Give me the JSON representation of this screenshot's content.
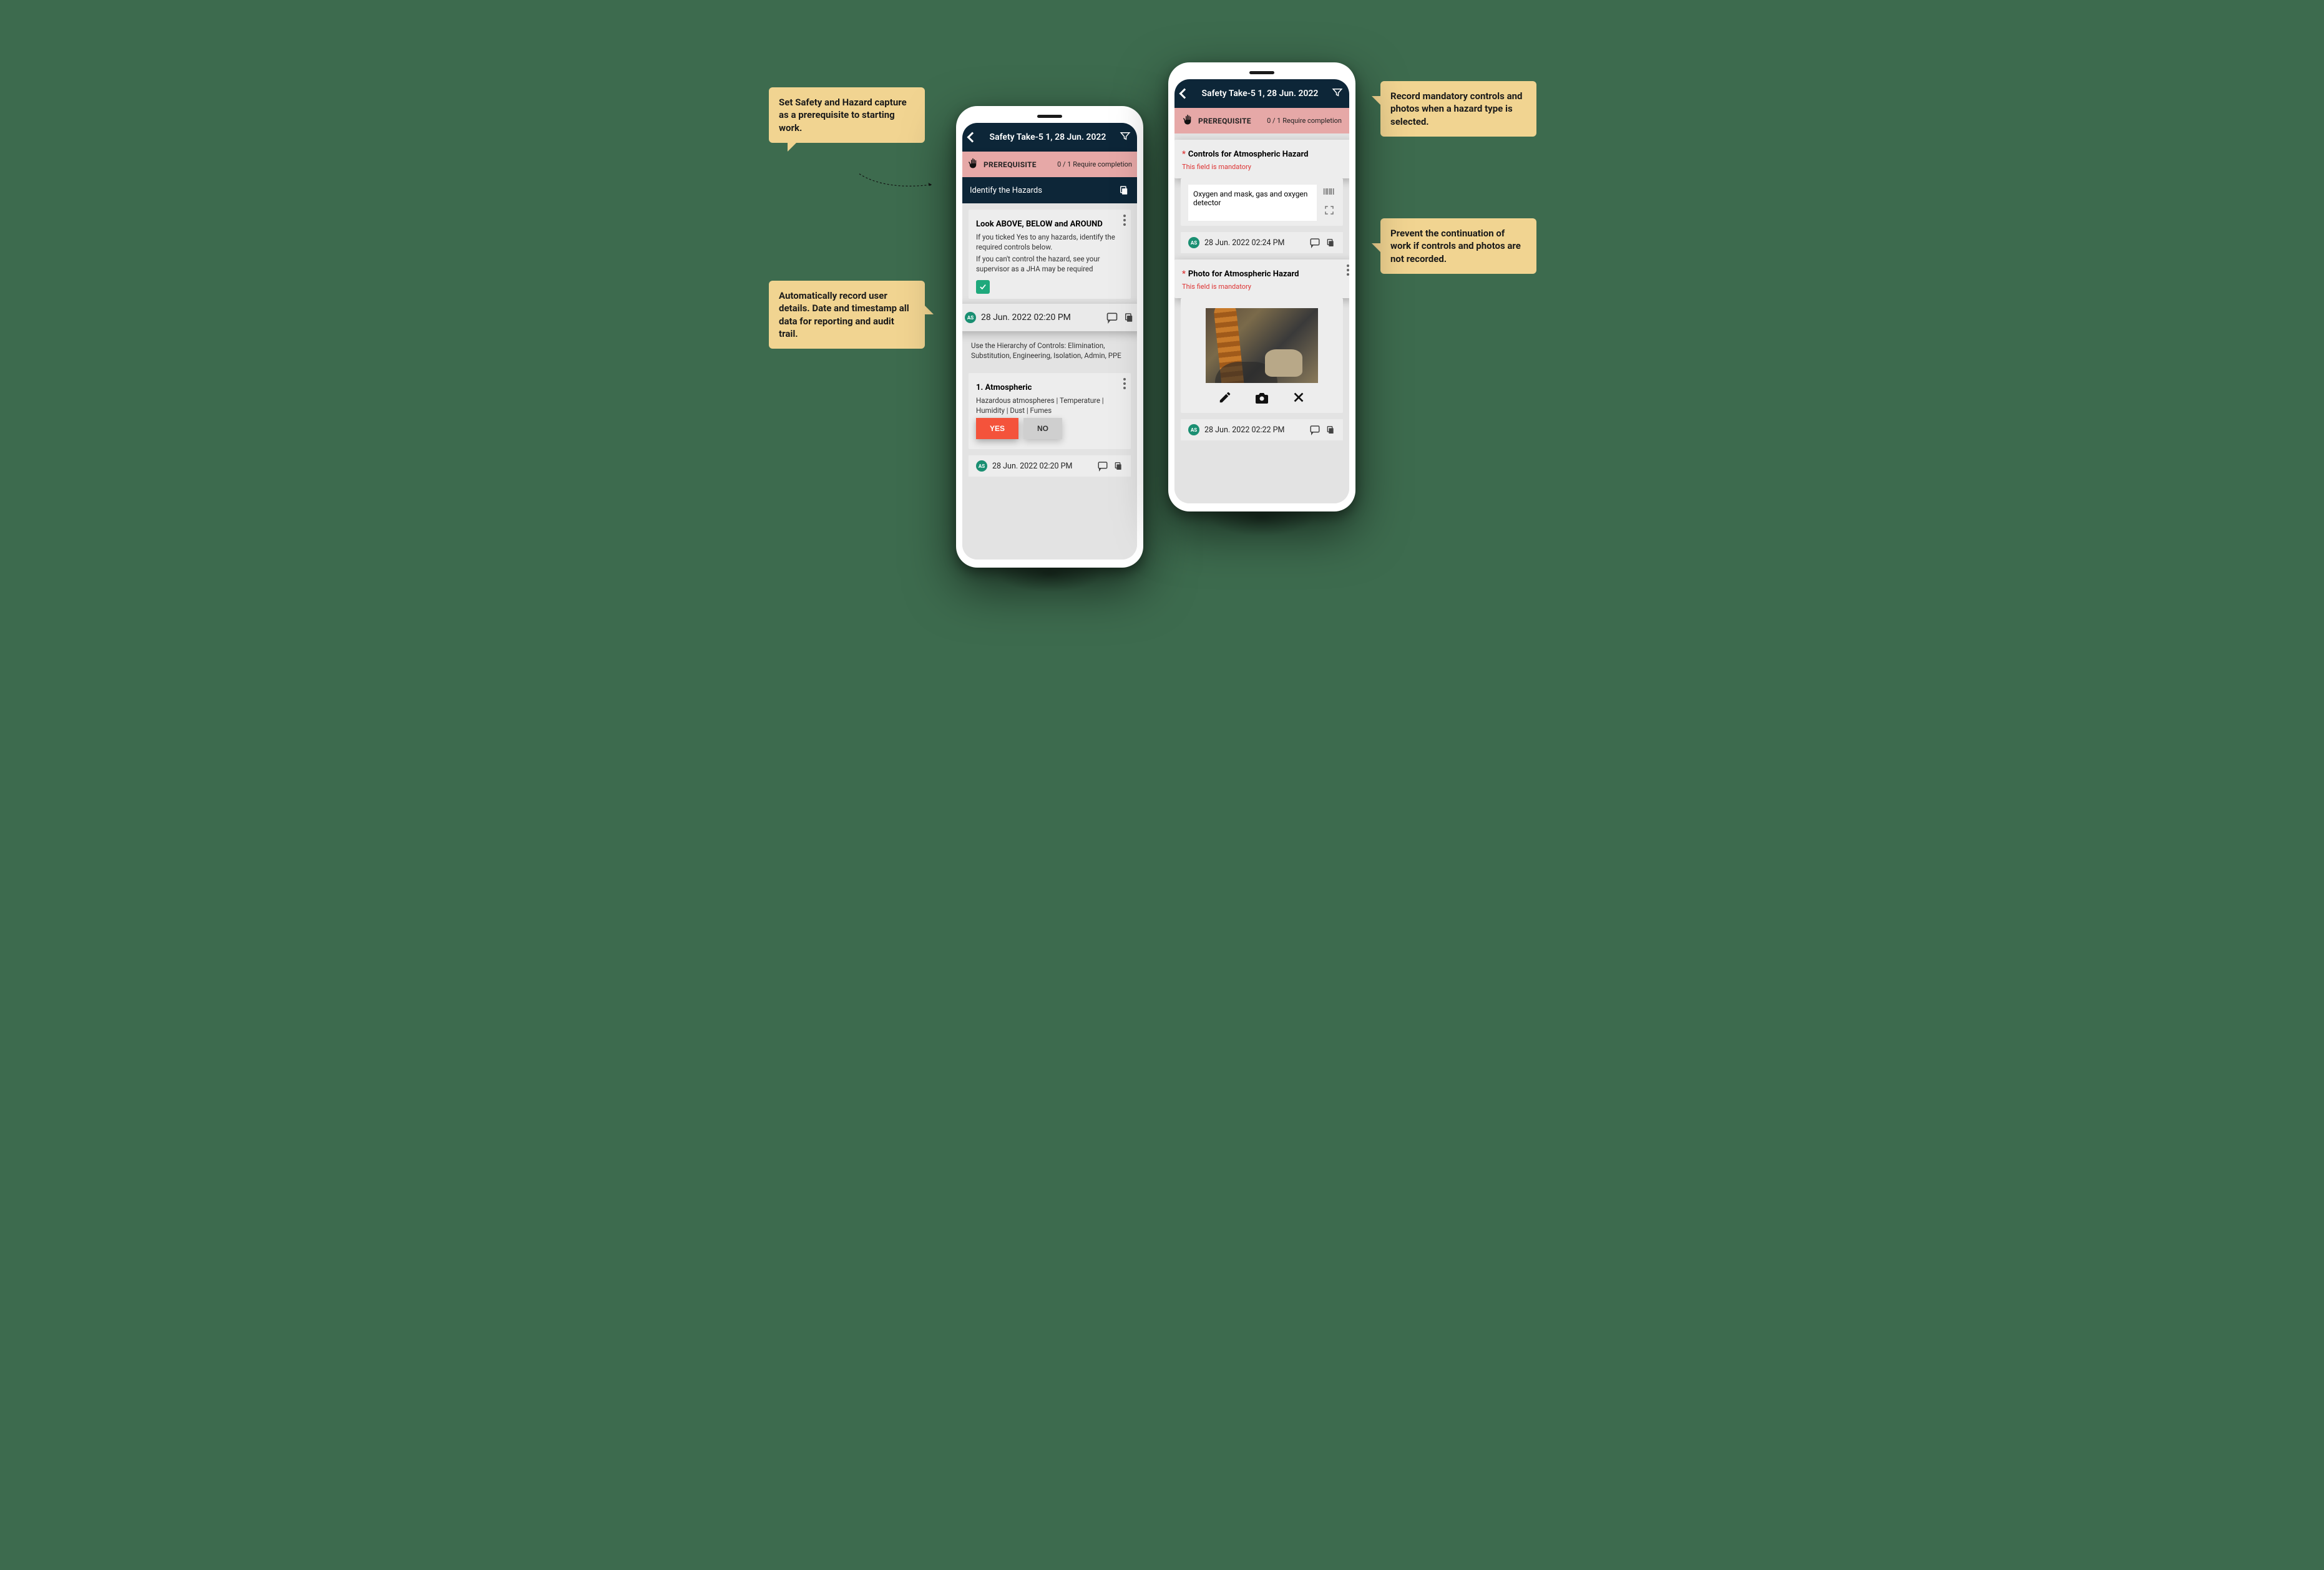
{
  "callouts": {
    "c1": "Set Safety and Hazard capture as a prerequisite to starting work.",
    "c2": "Automatically record user details. Date and timestamp all data for reporting and audit trail.",
    "c3": "Record mandatory controls and photos when a hazard type is selected.",
    "c4": "Prevent the continuation of work if controls and photos are not recorded."
  },
  "phone1": {
    "title": "Safety Take-5 1, 28 Jun. 2022",
    "prereq": {
      "label": "PREREQUISITE",
      "count": "0 / 1 Require completion"
    },
    "section": "Identify the Hazards",
    "look": {
      "heading": "Look ABOVE, BELOW and AROUND",
      "body1": "If you ticked Yes to any hazards, identify the required controls  below.",
      "body2": "If you can't control the hazard, see your supervisor as a JHA may be required"
    },
    "avatar": "AS",
    "timestamp1": "28 Jun. 2022 02:20 PM",
    "hierarchy": "Use the Hierarchy of Controls: Elimination, Substitution, Engineering, Isolation, Admin, PPE",
    "hazard1": {
      "heading": "1. Atmospheric",
      "body": "Hazardous atmospheres | Temperature | Humidity | Dust | Fumes",
      "yes": "YES",
      "no": "NO"
    },
    "timestamp2": "28 Jun. 2022 02:20 PM"
  },
  "phone2": {
    "title": "Safety Take-5 1, 28 Jun. 2022",
    "prereq": {
      "label": "PREREQUISITE",
      "count": "0 / 1 Require completion"
    },
    "controls": {
      "heading": "Controls for Atmospheric Hazard",
      "mandatory": "This field is mandatory",
      "value": "Oxygen and mask, gas and oxygen detector"
    },
    "avatar": "AS",
    "timestamp1": "28 Jun. 2022 02:24 PM",
    "photo": {
      "heading": "Photo for Atmospheric Hazard",
      "mandatory": "This field is mandatory"
    },
    "timestamp2": "28 Jun. 2022 02:22 PM"
  }
}
